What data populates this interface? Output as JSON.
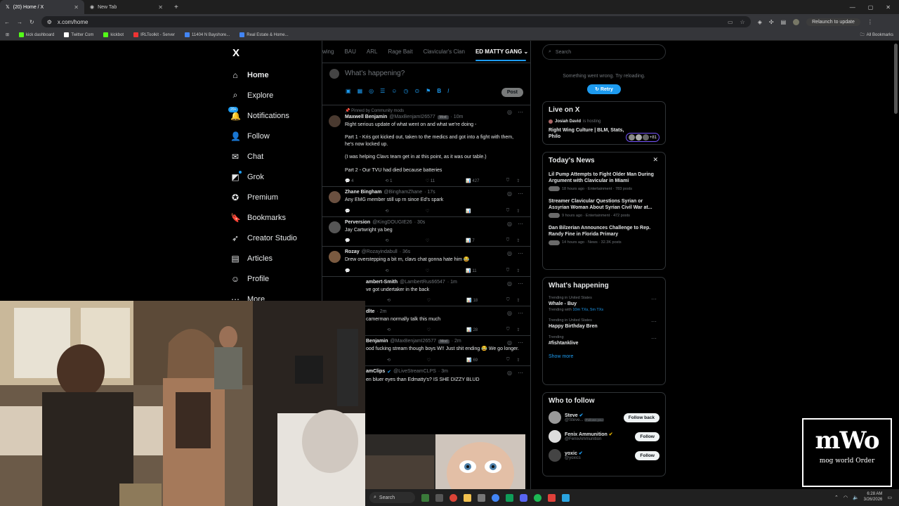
{
  "browser": {
    "tabs": [
      {
        "title": "(20) Home / X"
      },
      {
        "title": "New Tab"
      }
    ],
    "url": "x.com/home",
    "relaunch": "Relaunch to update",
    "bookmarks": [
      "kick dashboard",
      "Twitter Com",
      "kickbot",
      "IRLToolkit - Server",
      "11404 N Bayshore...",
      "Real Estate & Home..."
    ],
    "all_bookmarks": "All Bookmarks"
  },
  "nav": {
    "logo": "X",
    "badge": "20+",
    "items": [
      "Home",
      "Explore",
      "Notifications",
      "Follow",
      "Chat",
      "Grok",
      "Premium",
      "Bookmarks",
      "Creator Studio",
      "Articles",
      "Profile",
      "More"
    ]
  },
  "feed": {
    "tabs": [
      "wing",
      "BAU",
      "ARL",
      "Rage Bait",
      "Clavicular's Clan",
      "ED MATTY GANG"
    ],
    "compose_placeholder": "What's happening?",
    "post_label": "Post",
    "pinned": "Pinned by Community mods",
    "tweets": [
      {
        "name": "Maxwell Benjamin",
        "handle": "@MaxBenjamI26577",
        "badge": "Mod",
        "time": "10m",
        "paragraphs": [
          "Right serious update of what went on and what we're doing -",
          "Part 1 - Kris got kicked out, taken to the medics and got into a fight with them, he's now locked up.",
          "(I was helping Clavs team get in at this point, as it was our table.)",
          "Part 2 - Our TVU had died because batteries"
        ],
        "replies": "4",
        "reposts": "1",
        "likes": "11",
        "views": "427"
      },
      {
        "name": "Zhane Bingham",
        "handle": "@BinghamZhane",
        "time": "17s",
        "paragraphs": [
          "Any EMG member still up rn since Ed's spark"
        ],
        "replies": "",
        "reposts": "",
        "likes": "",
        "views": ""
      },
      {
        "name": "Perversion",
        "handle": "@KingDOUGIE26",
        "time": "30s",
        "paragraphs": [
          "Jay Cartwright ya beg"
        ],
        "replies": "",
        "reposts": "",
        "likes": "",
        "views": "7"
      },
      {
        "name": "Rozay",
        "handle": "@Rozayindabull",
        "time": "36s",
        "paragraphs": [
          "Drew overstepping a bit rn, clavs chat gonna hate him 😂"
        ],
        "replies": "",
        "reposts": "",
        "likes": "",
        "views": "11"
      },
      {
        "name": "ambert-Smith",
        "handle": "@LambertRus66547",
        "time": "1m",
        "paragraphs": [
          "ve got undertaker in the back"
        ],
        "replies": "",
        "reposts": "",
        "likes": "",
        "views": "18"
      },
      {
        "name": "dlte",
        "handle": "",
        "time": "2m",
        "paragraphs": [
          "camerman normally talk this much"
        ],
        "replies": "",
        "reposts": "",
        "likes": "",
        "views": "28"
      },
      {
        "name": "Benjamin",
        "handle": "@MaxBenjamI26577",
        "badge": "Mod",
        "time": "2m",
        "paragraphs": [
          "ood fucking stream though boys W!! Just shit ending 😂 We go longer."
        ],
        "replies": "",
        "reposts": "",
        "likes": "",
        "views": "69"
      },
      {
        "name": "amClips",
        "handle": "@LiveStreamCLPS",
        "time": "3m",
        "paragraphs": [
          "en bluer eyes than Edmatty's? IS SHE DIZZY BLUD"
        ],
        "replies": "",
        "reposts": "",
        "likes": "",
        "views": ""
      }
    ]
  },
  "right": {
    "search_placeholder": "Search",
    "error_text": "Something went wrong. Try reloading.",
    "retry": "Retry",
    "live": {
      "title": "Live on X",
      "host": "Josiah David",
      "hosting": "is hosting",
      "space_title": "Right Wing Culture | BLM, Stats, Philo",
      "count": "+81"
    },
    "news": {
      "title": "Today's News",
      "items": [
        {
          "title": "Lil Pump Attempts to Fight Older Man During Argument with Clavicular in Miami",
          "meta": "18 hours ago · Entertainment · 783 posts"
        },
        {
          "title": "Streamer Clavicular Questions Syrian or Assyrian Woman About Syrian Civil War at...",
          "meta": "9 hours ago · Entertainment · 472 posts"
        },
        {
          "title": "Dan Bilzerian Announces Challenge to Rep. Randy Fine in Florida Primary",
          "meta": "14 hours ago · News · 32.3K posts"
        }
      ]
    },
    "happening": {
      "title": "What's happening",
      "trends": [
        {
          "context": "Trending in United States",
          "name": "Whale - Buy",
          "with_label": "Trending with",
          "with": "10m TXs, 5m TXs"
        },
        {
          "context": "Trending in United States",
          "name": "Happy Birthday Bren",
          "with_label": "",
          "with": ""
        },
        {
          "context": "Trending",
          "name": "#fishtanklive",
          "with_label": "",
          "with": ""
        }
      ],
      "show_more": "Show more"
    },
    "follow": {
      "title": "Who to follow",
      "people": [
        {
          "name": "Steve",
          "handle": "@Steve...",
          "follows_you": "Follows you",
          "button": "Follow back"
        },
        {
          "name": "Fenix Ammunition",
          "handle": "@FenixAmmunition",
          "follows_you": "",
          "button": "Follow"
        },
        {
          "name": "yoxic",
          "handle": "@yoxics",
          "follows_you": "",
          "button": "Follow"
        }
      ]
    }
  },
  "taskbar": {
    "search": "Search",
    "time": "6:28 AM",
    "date": "3/26/2026"
  },
  "overlay": {
    "logo_big": "mWo",
    "logo_small": "mog world Order"
  }
}
